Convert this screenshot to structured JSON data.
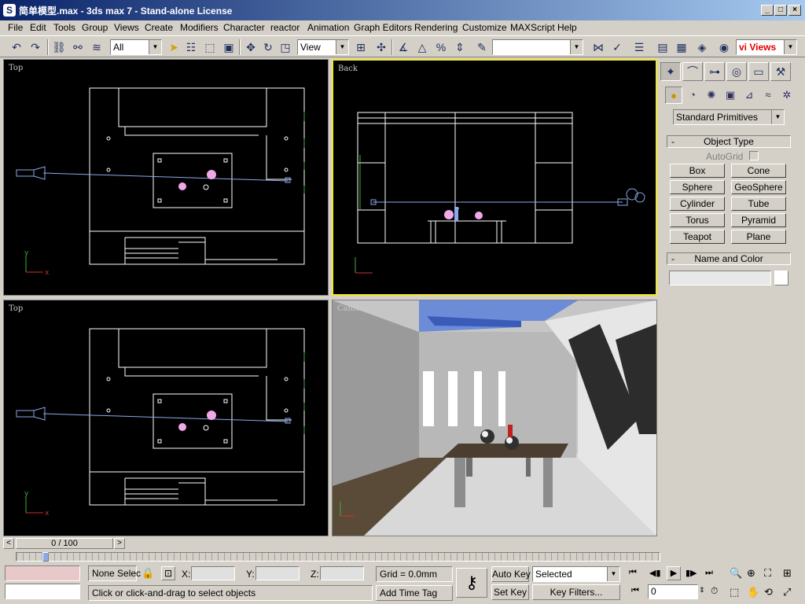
{
  "window": {
    "title": "简单模型.max - 3ds max 7  - Stand-alone License",
    "icon": "3ds-max-icon",
    "minimize": "_",
    "maximize": "□",
    "close": "×"
  },
  "menu": [
    "File",
    "Edit",
    "Tools",
    "Group",
    "Views",
    "Create",
    "Modifiers",
    "Character",
    "reactor",
    "Animation",
    "Graph Editors",
    "Rendering",
    "Customize",
    "MAXScript",
    "Help"
  ],
  "toolbar": {
    "selection_filter": "All",
    "reference_coord": "View",
    "named_selection": ""
  },
  "viewports": {
    "top_left": "Top",
    "top_right": "Back",
    "bottom_left": "Top",
    "bottom_right": "Camera01"
  },
  "axes": {
    "x": "x",
    "y": "y"
  },
  "command_panel": {
    "category": "Standard Primitives",
    "object_type_title": "Object Type",
    "autogrid": "AutoGrid",
    "primitives": [
      "Box",
      "Cone",
      "Sphere",
      "GeoSphere",
      "Cylinder",
      "Tube",
      "Torus",
      "Pyramid",
      "Teapot",
      "Plane"
    ],
    "name_color_title": "Name and Color",
    "name_value": "",
    "collapse_symbol": "-"
  },
  "timeline": {
    "frame_counter": "0 / 100",
    "prev": "<",
    "next": ">"
  },
  "status": {
    "selection": "None Selec",
    "x_label": "X:",
    "y_label": "Y:",
    "z_label": "Z:",
    "x_value": "",
    "y_value": "",
    "z_value": "",
    "grid": "Grid = 0.0mm",
    "prompt": "Click or click-and-drag to select objects",
    "add_time_tag": "Add Time Tag",
    "auto_key": "Auto Key",
    "set_key": "Set Key",
    "key_mode": "Selected",
    "key_filters": "Key Filters...",
    "current_frame": "0"
  },
  "watermark": "vi Views",
  "colors": {
    "active_viewport_border": "#f2e82a",
    "wireframe": "#ffffff",
    "camera_blue": "#8ca8e8",
    "sphere_pink": "#f0a8e8"
  }
}
